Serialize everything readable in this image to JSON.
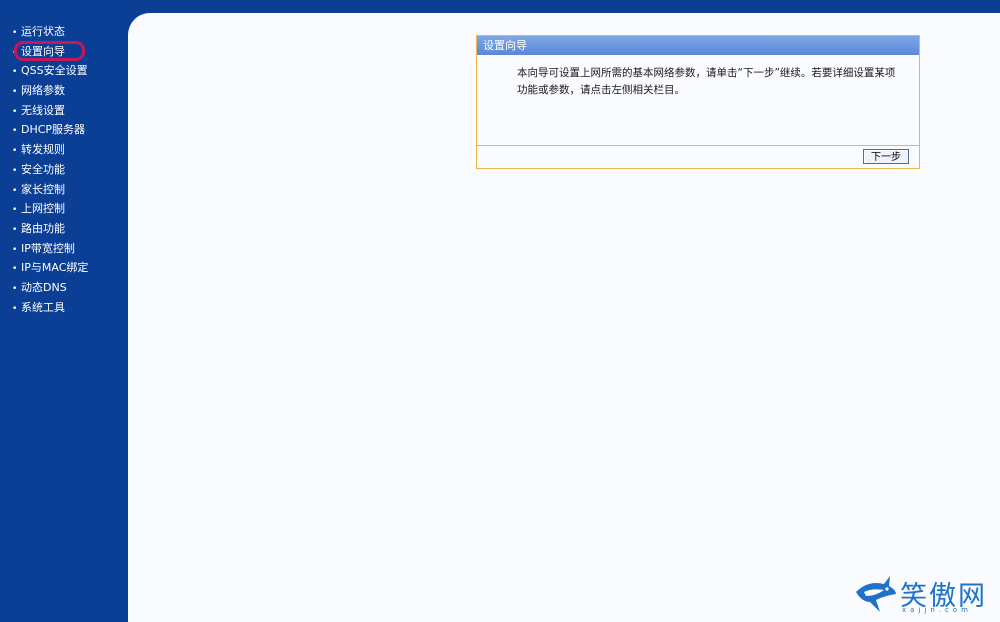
{
  "sidebar": {
    "items": [
      {
        "label": "运行状态"
      },
      {
        "label": "设置向导"
      },
      {
        "label": "QSS安全设置"
      },
      {
        "label": "网络参数"
      },
      {
        "label": "无线设置"
      },
      {
        "label": "DHCP服务器"
      },
      {
        "label": "转发规则"
      },
      {
        "label": "安全功能"
      },
      {
        "label": "家长控制"
      },
      {
        "label": "上网控制"
      },
      {
        "label": "路由功能"
      },
      {
        "label": "IP带宽控制"
      },
      {
        "label": "IP与MAC绑定"
      },
      {
        "label": "动态DNS"
      },
      {
        "label": "系统工具"
      }
    ],
    "bullet": "•"
  },
  "wizard": {
    "title": "设置向导",
    "text": "本向导可设置上网所需的基本网络参数，请单击“下一步”继续。若要详细设置某项功能或参数，请点击左侧相关栏目。",
    "next_label": "下一步"
  },
  "watermark": {
    "text": "笑傲网",
    "sub": "xajjn.com",
    "icon": "shark-icon"
  },
  "colors": {
    "sidebar_bg": "#0b3f96",
    "highlight": "#c2185b",
    "panel_border": "#e8b64c",
    "title_bar": "#5b87d6"
  }
}
